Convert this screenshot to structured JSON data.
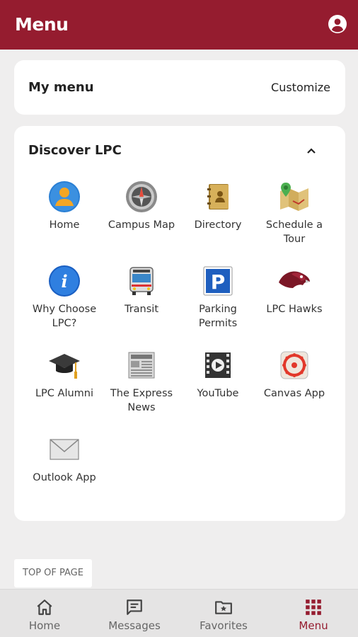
{
  "header": {
    "title": "Menu",
    "profile_icon": "account-circle-icon"
  },
  "my_menu": {
    "label": "My menu",
    "customize_label": "Customize"
  },
  "discover": {
    "label": "Discover LPC",
    "collapse_icon": "chevron-up-icon",
    "items": [
      {
        "label": "Home",
        "icon": "person-icon"
      },
      {
        "label": "Campus Map",
        "icon": "compass-icon"
      },
      {
        "label": "Directory",
        "icon": "address-book-icon"
      },
      {
        "label": "Schedule a Tour",
        "icon": "map-pin-icon"
      },
      {
        "label": "Why Choose LPC?",
        "icon": "info-icon"
      },
      {
        "label": "Transit",
        "icon": "bus-icon"
      },
      {
        "label": "Parking Permits",
        "icon": "parking-icon"
      },
      {
        "label": "LPC Hawks",
        "icon": "hawk-icon"
      },
      {
        "label": "LPC Alumni",
        "icon": "graduation-cap-icon"
      },
      {
        "label": "The Express News",
        "icon": "newspaper-icon"
      },
      {
        "label": "YouTube",
        "icon": "video-icon"
      },
      {
        "label": "Canvas App",
        "icon": "canvas-icon"
      },
      {
        "label": "Outlook App",
        "icon": "envelope-icon"
      }
    ]
  },
  "top_of_page_label": "TOP OF PAGE",
  "bottom_nav": {
    "items": [
      {
        "label": "Home",
        "icon": "home-icon",
        "active": false
      },
      {
        "label": "Messages",
        "icon": "chat-icon",
        "active": false
      },
      {
        "label": "Favorites",
        "icon": "favorites-folder-icon",
        "active": false
      },
      {
        "label": "Menu",
        "icon": "grid-icon",
        "active": true
      }
    ]
  },
  "colors": {
    "brand": "#951c2f",
    "background": "#efeeee"
  }
}
